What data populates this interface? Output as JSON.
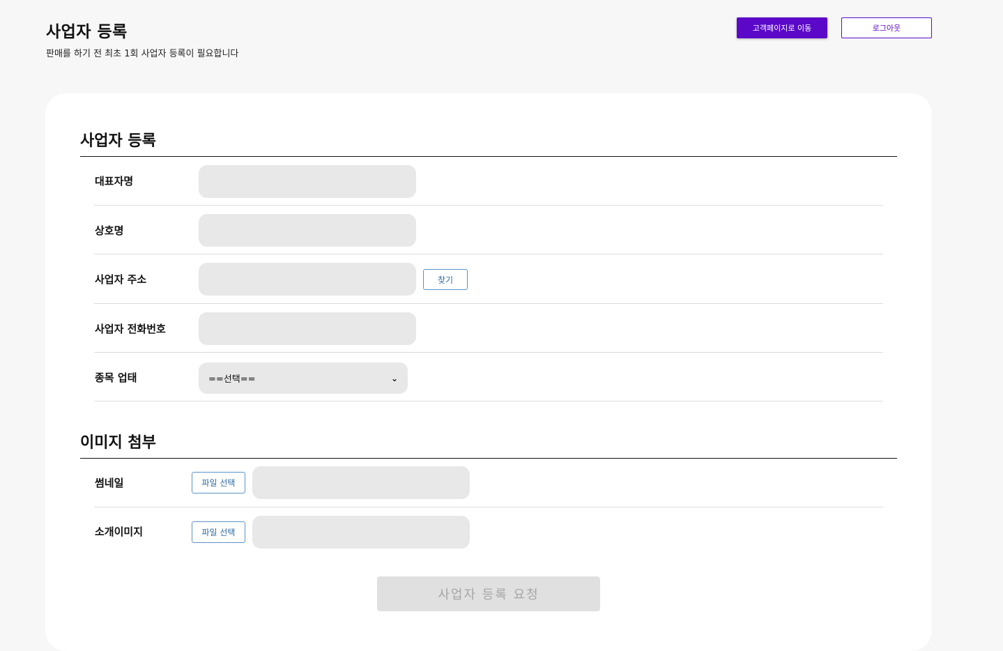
{
  "header": {
    "title": "사업자 등록",
    "subtitle": "판매를 하기 전 최초 1회 사업자 등록이 필요합니다",
    "customer_button": "고객페이지로 이동",
    "logout_button": "로그아웃"
  },
  "business_section": {
    "title": "사업자 등록",
    "fields": [
      {
        "label": "대표자명",
        "value": ""
      },
      {
        "label": "상호명",
        "value": ""
      },
      {
        "label": "사업자 주소",
        "value": "",
        "button": "찾기"
      },
      {
        "label": "사업자 전화번호",
        "value": ""
      },
      {
        "label": "종목 업태",
        "selected": "==선택=="
      }
    ]
  },
  "image_section": {
    "title": "이미지 첨부",
    "fields": [
      {
        "label": "썸네일",
        "button": "파일 선택"
      },
      {
        "label": "소개이미지",
        "button": "파일 선택"
      }
    ]
  },
  "submit_button": "사업자 등록 요청",
  "colors": {
    "accent": "#5b08c9",
    "file_button_border": "#5b93c6",
    "input_bg": "#e8e8e8",
    "page_bg": "#f7f7f7"
  },
  "icons": {
    "select_chevron": "chevron-down-icon"
  }
}
